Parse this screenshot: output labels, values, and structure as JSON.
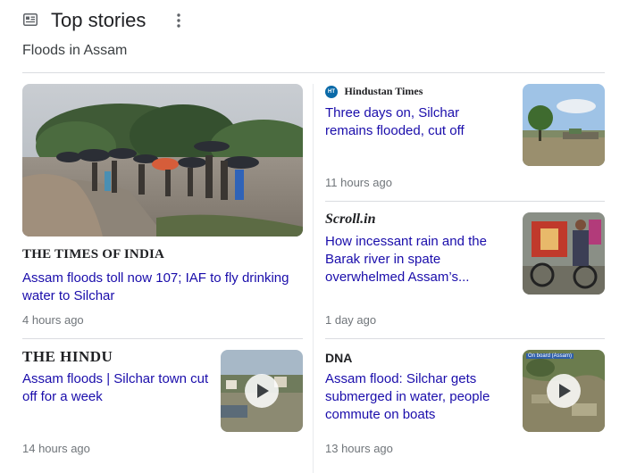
{
  "header": {
    "title": "Top stories",
    "topic": "Floods in Assam",
    "more_icon": "more-vert-icon",
    "section_icon": "newspaper-icon"
  },
  "stories": {
    "toi": {
      "publisher": "THE TIMES OF INDIA",
      "headline": "Assam floods toll now 107; IAF to fly drinking water to Silchar",
      "time": "4 hours ago"
    },
    "ht": {
      "publisher_badge": "HT",
      "publisher": "Hindustan Times",
      "headline": "Three days on, Silchar remains flooded, cut off",
      "time": "11 hours ago"
    },
    "scroll": {
      "publisher": "Scroll.in",
      "headline": "How incessant rain and the Barak river in spate overwhelmed Assam’s...",
      "time": "1 day ago"
    },
    "hindu": {
      "publisher": "THE HINDU",
      "headline": "Assam floods | Silchar town cut off for a week",
      "time": "14 hours ago"
    },
    "dna": {
      "publisher": "DNA",
      "headline": "Assam flood: Silchar gets submerged in water, people commute on boats",
      "time": "13 hours ago",
      "video_label": "On board (Assam)"
    }
  },
  "colors": {
    "link": "#1a0dab",
    "meta": "#70757a",
    "divider": "#dadce0",
    "ht_badge": "#0a6aa8"
  }
}
